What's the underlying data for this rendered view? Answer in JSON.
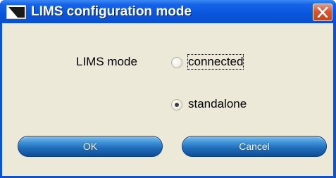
{
  "dialog": {
    "title": "LIMS configuration mode",
    "close_icon": "close-icon",
    "app_icon": "window-icon"
  },
  "form": {
    "mode_label": "LIMS mode",
    "options": [
      {
        "label": "connected",
        "selected": false
      },
      {
        "label": "standalone",
        "selected": true
      }
    ]
  },
  "buttons": {
    "ok_label": "OK",
    "cancel_label": "Cancel"
  },
  "colors": {
    "titlebar": "#0a54d4",
    "client_bg": "#ece9d8",
    "close_button": "#d9542e",
    "button_blue": "#1f6cb8"
  }
}
